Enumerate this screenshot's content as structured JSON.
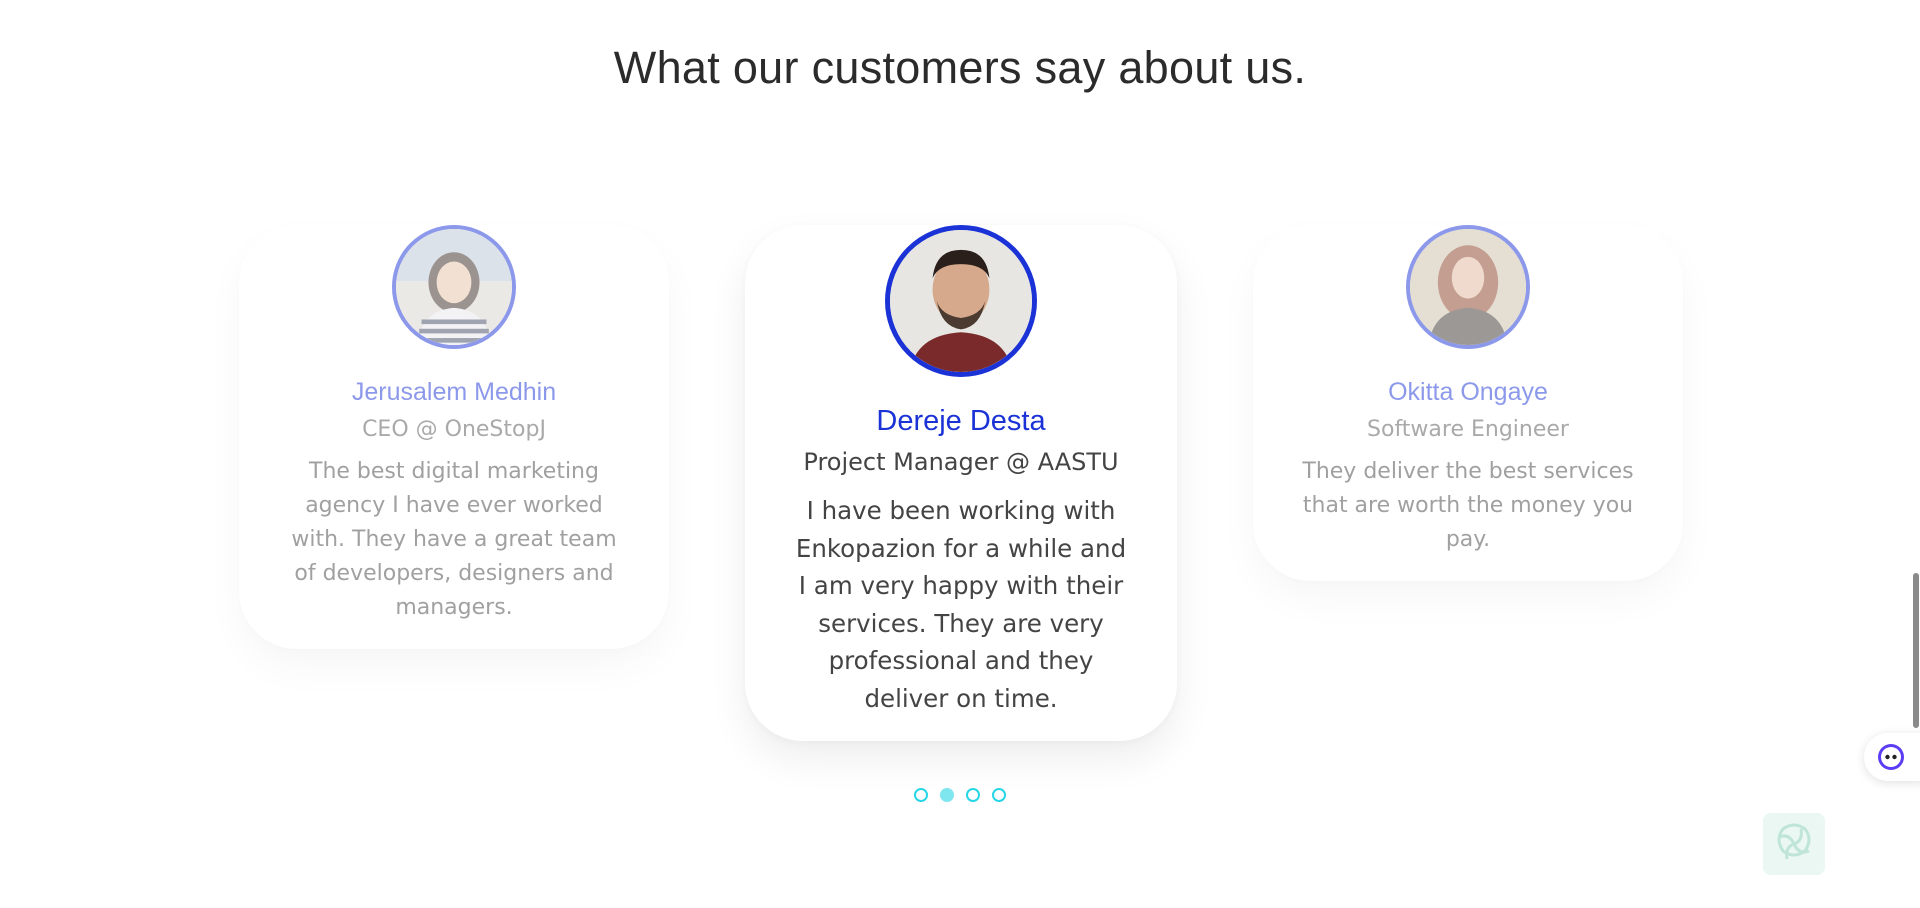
{
  "testimonials": {
    "heading": "What our customers say about us.",
    "items": [
      {
        "name": "Jerusalem Medhin",
        "role": "CEO @ OneStopJ",
        "quote": "The best digital marketing agency I have ever worked with. They have a great team of developers, designers and managers."
      },
      {
        "name": "Dereje Desta",
        "role": "Project Manager @ AASTU",
        "quote": "I have been working with Enkopazion for a while and I am very happy with their services. They are very professional and they deliver on time."
      },
      {
        "name": "Okitta Ongaye",
        "role": "Software Engineer",
        "quote": "They deliver the best services that are worth the money you pay."
      }
    ]
  },
  "carousel": {
    "dot_count": 4,
    "active_index": 1
  },
  "colors": {
    "accent": "#1b33d6",
    "dot": "#26d6e6",
    "heading": "#2b2b2b"
  }
}
